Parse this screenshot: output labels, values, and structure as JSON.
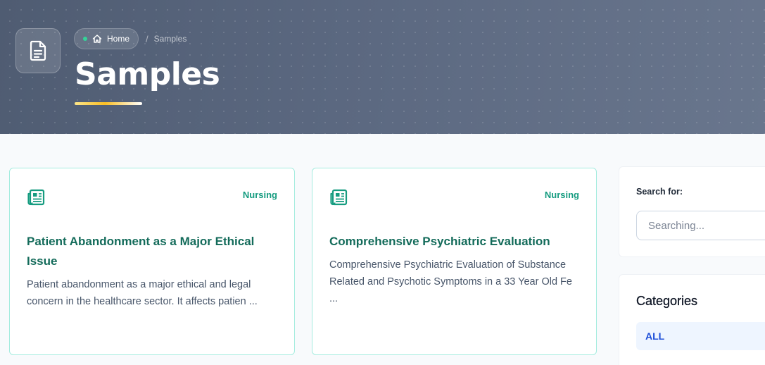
{
  "header": {
    "icon": "document-icon",
    "breadcrumb": {
      "home_label": "Home",
      "separator": "/",
      "current_label": "Samples"
    },
    "title": "Samples"
  },
  "cards": [
    {
      "icon": "newspaper-icon",
      "category": "Nursing",
      "title": "Patient Abandonment as a Major Ethical Issue",
      "description": "Patient abandonment as a major ethical and legal concern in the healthcare sector. It affects patien ..."
    },
    {
      "icon": "newspaper-icon",
      "category": "Nursing",
      "title": "Comprehensive Psychiatric Evaluation",
      "description": "Comprehensive Psychiatric Evaluation of Substance Related and Psychotic Symptoms in a 33 Year Old Fe ..."
    }
  ],
  "sidebar": {
    "search": {
      "label": "Search for:",
      "placeholder": "Searching...",
      "value": ""
    },
    "categories": {
      "heading": "Categories",
      "items": [
        {
          "label": "ALL",
          "active": true
        }
      ]
    }
  },
  "colors": {
    "accent": "#169c80",
    "card_title": "#136b5a",
    "card_border": "#a5ecdf",
    "active_category": "#1d4ed8",
    "hero_background": "#5b6880",
    "underline": "#fbbf24"
  }
}
